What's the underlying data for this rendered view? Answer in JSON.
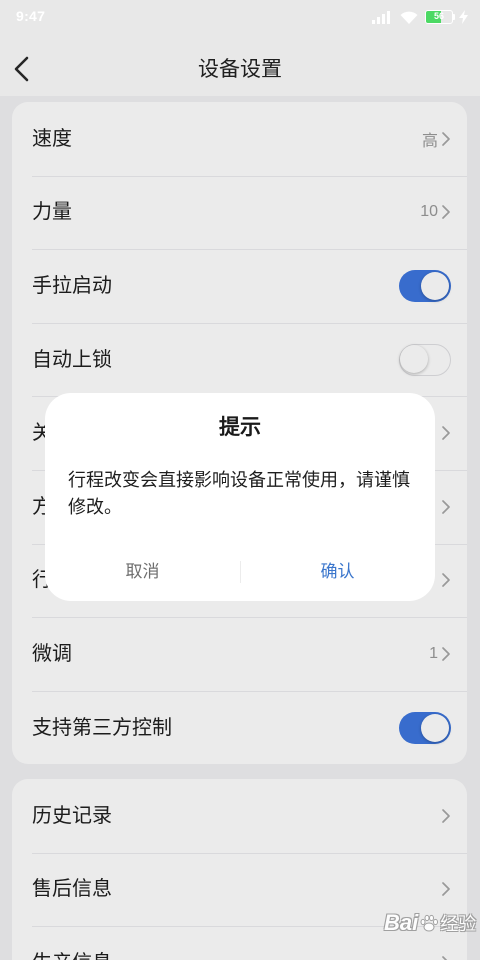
{
  "status_bar": {
    "time": "9:47",
    "battery_level": 56,
    "icons": [
      "signal-icon",
      "wifi-icon",
      "battery-icon",
      "charging-icon"
    ]
  },
  "header": {
    "title": "设备设置",
    "back_icon": "chevron-left-icon"
  },
  "settings_group_1": {
    "items": [
      {
        "label": "速度",
        "value": "高",
        "icon": "chevron-right-icon"
      },
      {
        "label": "力量",
        "value": "10",
        "icon": "chevron-right-icon"
      },
      {
        "label": "手拉启动",
        "toggle_on": true
      },
      {
        "label": "自动上锁",
        "toggle_on": false
      },
      {
        "label": "关",
        "icon": "chevron-right-icon"
      },
      {
        "label": "方",
        "icon": "chevron-right-icon"
      },
      {
        "label": "行",
        "icon": "chevron-right-icon"
      },
      {
        "label": "微调",
        "value": "1",
        "icon": "chevron-right-icon"
      },
      {
        "label": "支持第三方控制",
        "toggle_on": true
      }
    ]
  },
  "settings_group_2": {
    "items": [
      {
        "label": "历史记录",
        "icon": "chevron-right-icon"
      },
      {
        "label": "售后信息",
        "icon": "chevron-right-icon"
      },
      {
        "label": "生产信息",
        "icon": "chevron-right-icon"
      }
    ]
  },
  "dialog": {
    "title": "提示",
    "message": "行程改变会直接影响设备正常使用，请谨慎修改。",
    "cancel_label": "取消",
    "confirm_label": "确认"
  },
  "watermark": {
    "brand": "Bai",
    "product": "经验",
    "logo_icon": "paw-icon"
  },
  "colors": {
    "accent": "#3d76df",
    "confirm_text": "#3b76cc",
    "cancel_text": "#6e6e6e",
    "battery": "#4cd964",
    "page_background": "#f1f1f4",
    "card_background": "#ffffff",
    "dim_overlay": "rgba(0,0,0,0.08)"
  }
}
